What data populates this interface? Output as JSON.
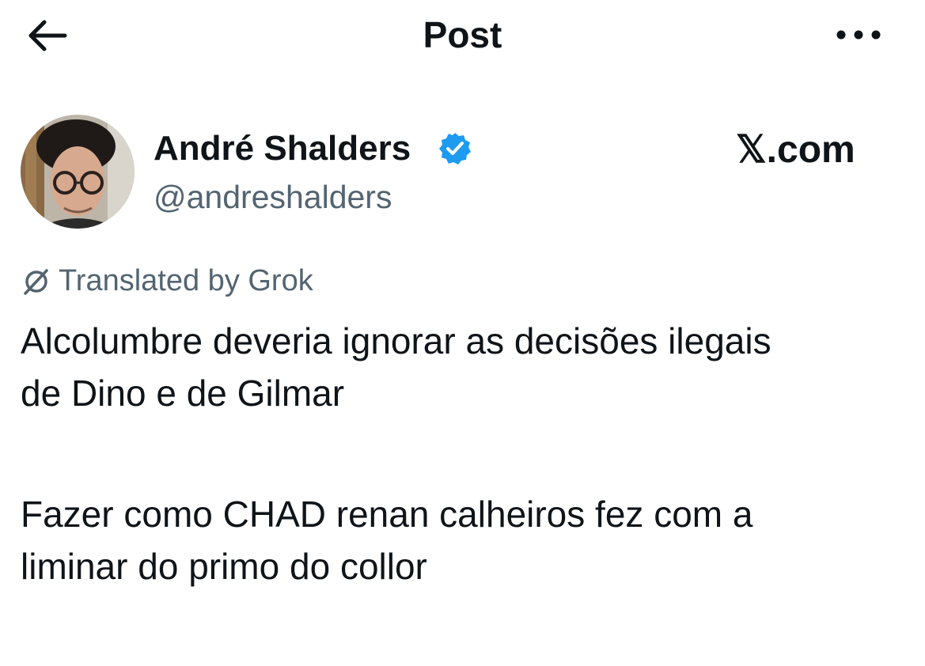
{
  "header": {
    "title": "Post",
    "back_icon": "arrow-left-icon",
    "more_icon": "more-horizontal-icon"
  },
  "author": {
    "display_name": "André Shalders",
    "handle": "@andreshalders",
    "verified_icon": "verified-badge-icon",
    "verified_color": "#1d9bf0"
  },
  "watermark": "𝕏.com",
  "translation": {
    "icon": "grok-icon",
    "label": "Translated by Grok"
  },
  "post": {
    "paragraph1_line1": "Alcolumbre deveria ignorar as decisões ilegais",
    "paragraph1_line2": "de Dino e de Gilmar",
    "paragraph2_line1": "Fazer como CHAD renan calheiros fez com a",
    "paragraph2_line2": "liminar do primo do collor"
  },
  "colors": {
    "text_primary": "#0f1419",
    "text_secondary": "#536471",
    "background": "#ffffff"
  }
}
